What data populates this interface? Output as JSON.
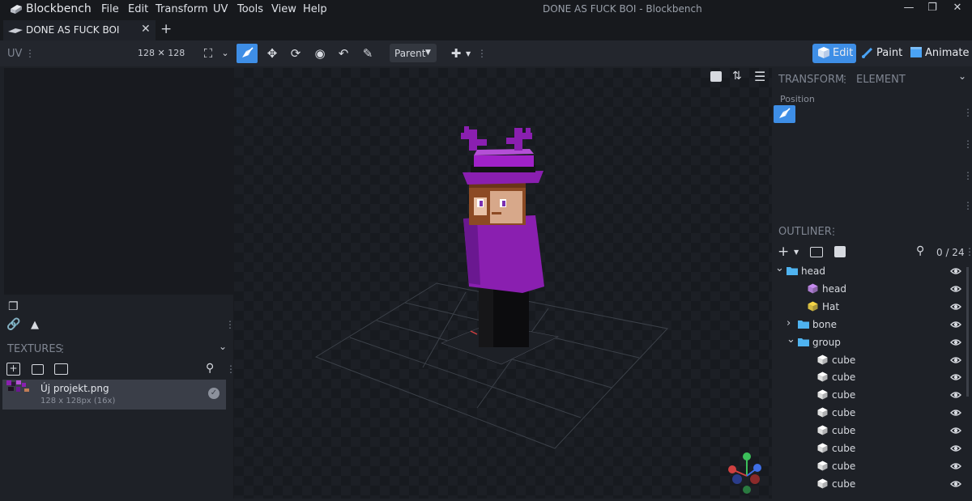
{
  "app": {
    "name": "Blockbench",
    "window_title": "DONE AS FUCK BOI - Blockbench",
    "menu": [
      "File",
      "Edit",
      "Transform",
      "UV",
      "Tools",
      "View",
      "Help"
    ]
  },
  "tabs": [
    {
      "label": "DONE AS FUCK BOI"
    }
  ],
  "toolbar": {
    "uv_label": "UV",
    "uv_size": "128 ✕ 128",
    "pivot_mode": "Parent",
    "modes": [
      "Edit",
      "Paint",
      "Animate"
    ]
  },
  "textures": {
    "title": "TEXTURES",
    "items": [
      {
        "name": "Új projekt.png",
        "meta": "128 x 128px (16x)"
      }
    ]
  },
  "transform": {
    "title": "TRANSFORM",
    "element_tab": "ELEMENT",
    "position_label": "Position"
  },
  "outliner": {
    "title": "OUTLINER",
    "count": "0 / 24",
    "rows": [
      {
        "label": "head",
        "kind": "folder",
        "expanded": true,
        "level": 0
      },
      {
        "label": "head",
        "kind": "cube-purple",
        "level": 1
      },
      {
        "label": "Hat",
        "kind": "cube-yellow",
        "level": 1
      },
      {
        "label": "bone",
        "kind": "folder",
        "expanded": false,
        "level": 1
      },
      {
        "label": "group",
        "kind": "folder",
        "expanded": true,
        "level": 1
      },
      {
        "label": "cube",
        "kind": "cube",
        "level": 2
      },
      {
        "label": "cube",
        "kind": "cube",
        "level": 2
      },
      {
        "label": "cube",
        "kind": "cube",
        "level": 2
      },
      {
        "label": "cube",
        "kind": "cube",
        "level": 2
      },
      {
        "label": "cube",
        "kind": "cube",
        "level": 2
      },
      {
        "label": "cube",
        "kind": "cube",
        "level": 2
      },
      {
        "label": "cube",
        "kind": "cube",
        "level": 2
      },
      {
        "label": "cube",
        "kind": "cube",
        "level": 2
      }
    ]
  },
  "colors": {
    "accent": "#3e8ee6",
    "purple": "#8a1fb0",
    "folder": "#4fb3f0",
    "cube_purple": "#c78cf0",
    "cube_yellow": "#f5d547"
  }
}
